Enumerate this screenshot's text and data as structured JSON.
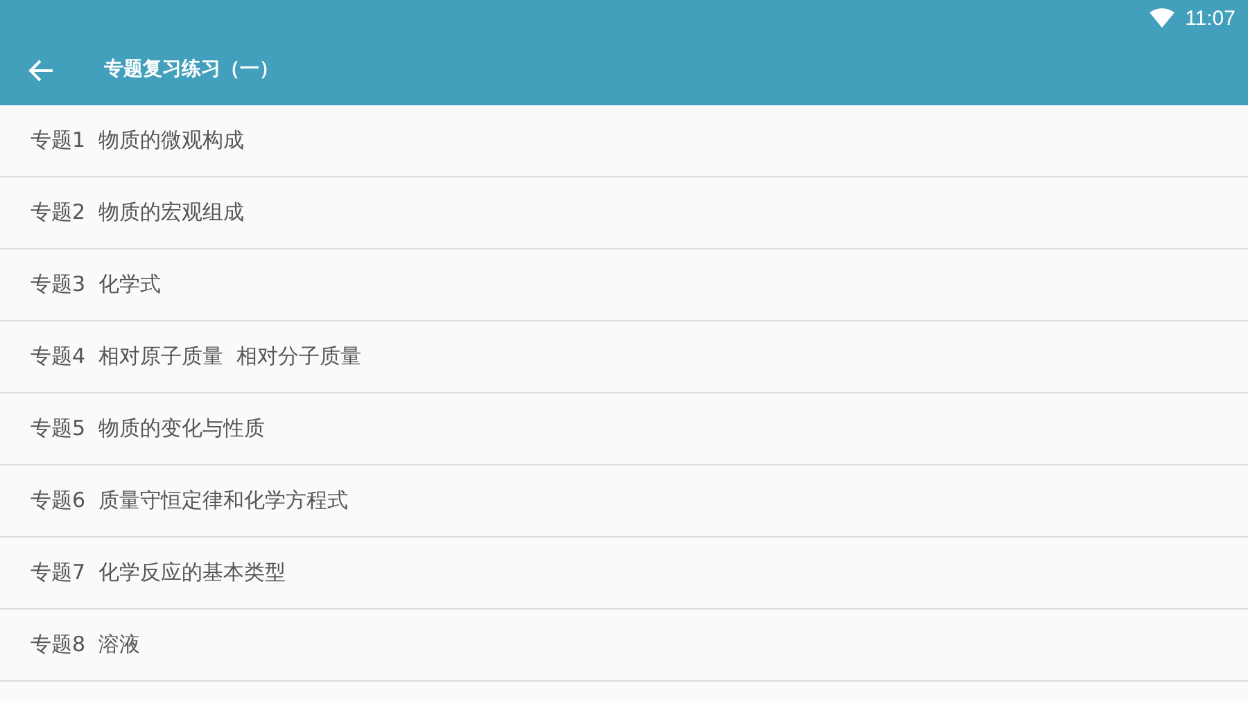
{
  "status_bar": {
    "time": "11:07"
  },
  "toolbar": {
    "title": "专题复习练习（一）"
  },
  "items": [
    {
      "label": "专题1  物质的微观构成"
    },
    {
      "label": "专题2  物质的宏观组成"
    },
    {
      "label": "专题3  化学式"
    },
    {
      "label": "专题4  相对原子质量  相对分子质量"
    },
    {
      "label": "专题5  物质的变化与性质"
    },
    {
      "label": "专题6  质量守恒定律和化学方程式"
    },
    {
      "label": "专题7  化学反应的基本类型"
    },
    {
      "label": "专题8  溶液"
    }
  ]
}
